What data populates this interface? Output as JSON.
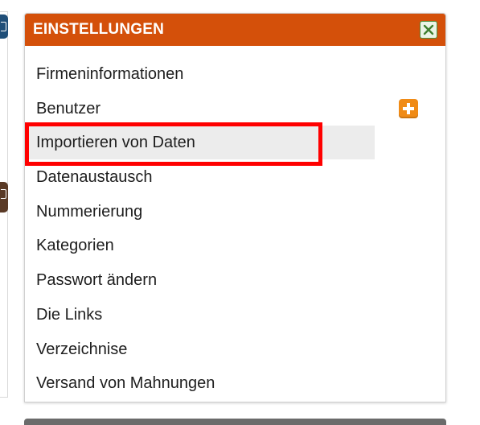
{
  "panel": {
    "title": "EINSTELLUNGEN",
    "close_icon": "close-icon",
    "colors": {
      "header": "#d4500a",
      "highlight": "#ff0000",
      "add_button": "#f08b16"
    }
  },
  "menu": {
    "items": [
      {
        "label": "Firmeninformationen"
      },
      {
        "label": "Benutzer",
        "add_icon": "plus-icon"
      },
      {
        "label": "Importieren von Daten",
        "highlighted": true
      },
      {
        "label": "Datenaustausch"
      },
      {
        "label": "Nummerierung"
      },
      {
        "label": "Kategorien"
      },
      {
        "label": "Passwort ändern"
      },
      {
        "label": "Die Links"
      },
      {
        "label": "Verzeichnise"
      },
      {
        "label": "Versand von Mahnungen"
      }
    ]
  }
}
